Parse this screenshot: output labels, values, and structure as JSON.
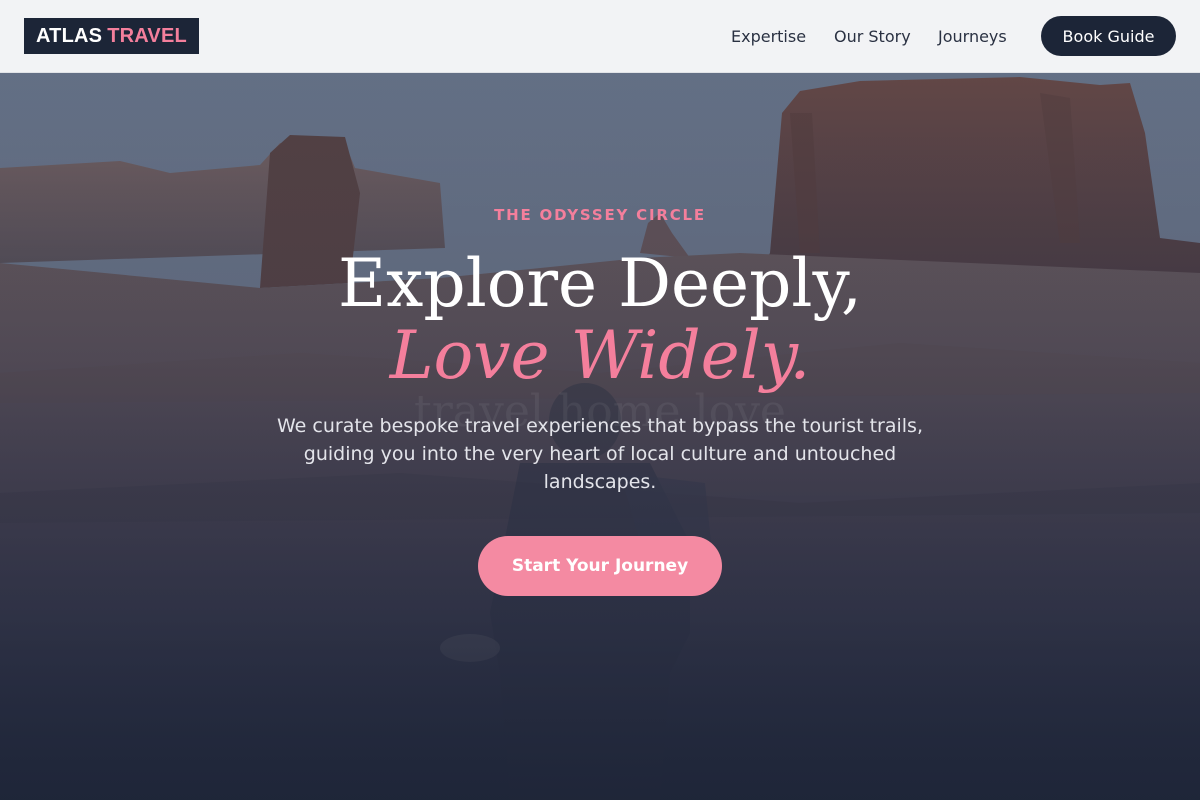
{
  "brand": {
    "word1": "ATLAS",
    "word2": "TRAVEL"
  },
  "nav": {
    "items": [
      "Expertise",
      "Our Story",
      "Journeys"
    ],
    "cta_label": "Book Guide"
  },
  "hero": {
    "eyebrow": "THE ODYSSEY CIRCLE",
    "title_line1": "Explore Deeply,",
    "title_line2": "Love Widely.",
    "ghost_text": "travel home love",
    "description": "We curate bespoke travel experiences that bypass the tourist trails, guiding you into the very heart of local culture and untouched landscapes.",
    "cta_label": "Start Your Journey",
    "background_image": "desert-monument-valley-traveler"
  },
  "colors": {
    "accent": "#f47f9c",
    "navy": "#1c2537",
    "header_bg": "#f2f3f5"
  }
}
